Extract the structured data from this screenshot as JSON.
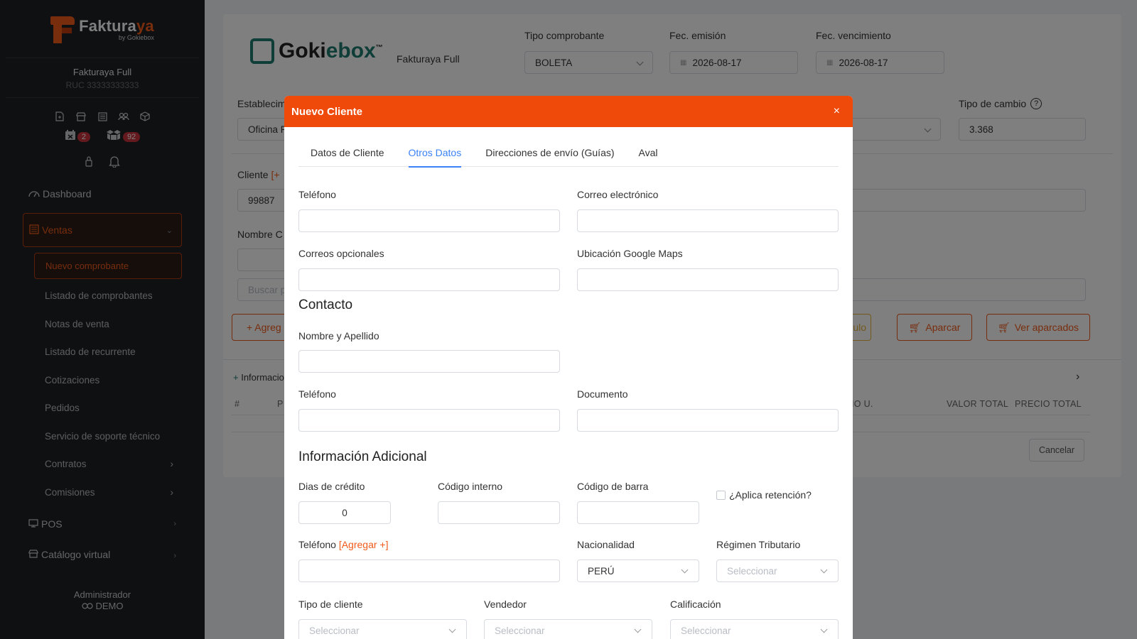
{
  "sidebar": {
    "brand_name_main": "Fakturaya",
    "brand_name_part1": "Faktura",
    "brand_name_part2": "ya",
    "brand_sub": "by Gokiebox",
    "company_name": "Fakturaya Full",
    "company_ruc": "RUC 33333333333",
    "badge_calendar": "2",
    "badge_box": "92",
    "nav": {
      "dashboard": "Dashboard",
      "ventas": "Ventas",
      "ventas_sub": [
        "Nuevo comprobante",
        "Listado de comprobantes",
        "Notas de venta",
        "Listado de recurrente",
        "Cotizaciones",
        "Pedidos",
        "Servicio de soporte técnico",
        "Contratos",
        "Comisiones"
      ],
      "pos": "POS",
      "catalogo": "Catálogo virtual"
    },
    "footer_user": "Administrador",
    "footer_demo": "DEMO"
  },
  "page": {
    "logo_part1": "Goki",
    "logo_part2": "ebox",
    "logo_tm": "™",
    "company": "Fakturaya Full",
    "tipo_comprobante_label": "Tipo comprobante",
    "tipo_comprobante_value": "BOLETA",
    "fec_emision_label": "Fec. emisión",
    "fec_emision_value": "2026-08-17",
    "fec_vencimiento_label": "Fec. vencimiento",
    "fec_vencimiento_value": "2026-08-17",
    "establecimiento_label": "Establecim",
    "establecimiento_value": "Oficina P",
    "tipo_cambio_label": "Tipo de cambio",
    "tipo_cambio_value": "3.368",
    "cliente_label": "Cliente",
    "cliente_add": "[+",
    "cliente_value": "99887",
    "nombre_label": "Nombre C",
    "buscar_placeholder": "Buscar p",
    "agregar_btn": "+ Agreg",
    "ulo_btn": "ulo",
    "aparcar_btn": "Aparcar",
    "ver_aparcados_btn": "Ver aparcados",
    "informacion": "Informacio",
    "table_headers": [
      "#",
      "P",
      "IO U.",
      "VALOR TOTAL",
      "PRECIO TOTAL"
    ],
    "cancelar_btn": "Cancelar"
  },
  "modal": {
    "title": "Nuevo Cliente",
    "close": "×",
    "tabs": [
      "Datos de Cliente",
      "Otros Datos",
      "Direcciones de envío (Guías)",
      "Aval"
    ],
    "telefono_label": "Teléfono",
    "correo_label": "Correo electrónico",
    "correos_opcionales_label": "Correos opcionales",
    "ubicacion_label": "Ubicación Google Maps",
    "contacto_title": "Contacto",
    "nombre_apellido_label": "Nombre y Apellido",
    "contacto_telefono_label": "Teléfono",
    "documento_label": "Documento",
    "info_adicional_title": "Información Adicional",
    "dias_credito_label": "Dias de crédito",
    "dias_credito_value": "0",
    "codigo_interno_label": "Código interno",
    "codigo_barra_label": "Código de barra",
    "aplica_retencion_label": "¿Aplica retención?",
    "telefono2_label": "Teléfono",
    "telefono2_add": "[Agregar +]",
    "nacionalidad_label": "Nacionalidad",
    "nacionalidad_value": "PERÚ",
    "regimen_label": "Régimen Tributario",
    "regimen_placeholder": "Seleccionar",
    "tipo_cliente_label": "Tipo de cliente",
    "tipo_cliente_placeholder": "Seleccionar",
    "vendedor_label": "Vendedor",
    "vendedor_placeholder": "Seleccionar",
    "calificacion_label": "Calificación",
    "calificacion_placeholder": "Seleccionar"
  },
  "colors": {
    "accent": "#f04a0a",
    "tab_active": "#3b82f6",
    "sidebar_bg": "#1f2125"
  }
}
